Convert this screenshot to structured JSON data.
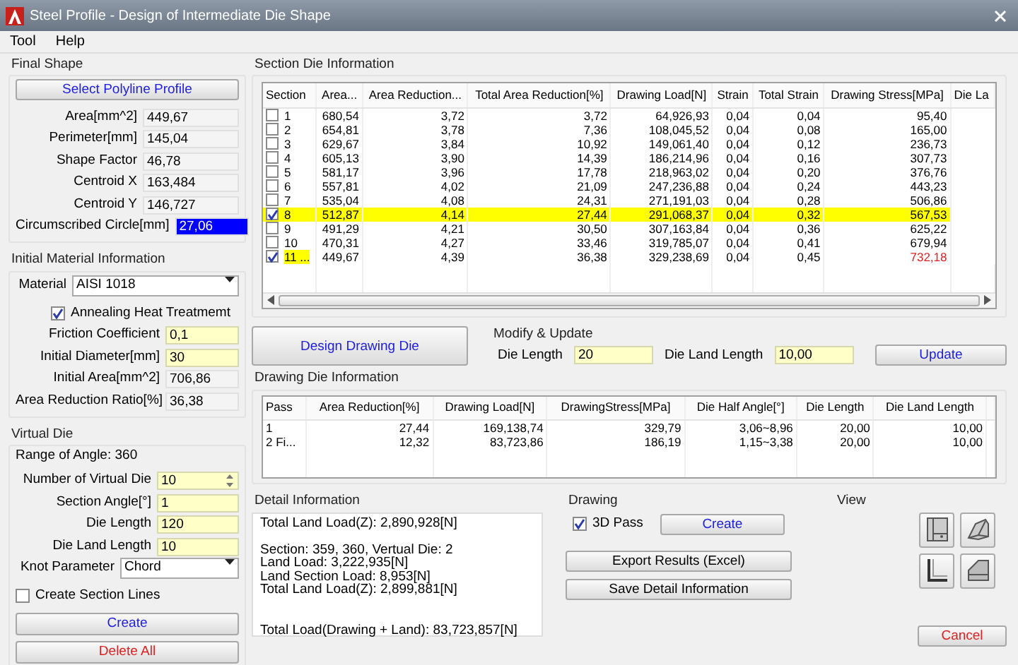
{
  "window": {
    "title": "Steel Profile - Design of Intermediate Die Shape"
  },
  "menu": [
    "Tool",
    "Help"
  ],
  "final_shape": {
    "title": "Final Shape",
    "button": "Select Polyline Profile",
    "fields": [
      {
        "label": "Area[mm^2]",
        "value": "449,67",
        "selected": false
      },
      {
        "label": "Perimeter[mm]",
        "value": "145,04",
        "selected": false
      },
      {
        "label": "Shape Factor",
        "value": "46,78",
        "selected": false
      },
      {
        "label": "Centroid X",
        "value": "163,484",
        "selected": false
      },
      {
        "label": "Centroid Y",
        "value": "146,727",
        "selected": false
      },
      {
        "label": "Circumscribed Circle[mm]",
        "value": "27,06",
        "selected": true
      }
    ]
  },
  "material": {
    "title": "Initial Material Information",
    "label": "Material",
    "value": "AISI 1018",
    "annealing": {
      "label": "Annealing Heat Treatmemt",
      "checked": true
    },
    "fields": [
      {
        "label": "Friction Coefficient",
        "value": "0,1",
        "editable": true
      },
      {
        "label": "Initial Diameter[mm]",
        "value": "30",
        "editable": true
      },
      {
        "label": "Initial Area[mm^2]",
        "value": "706,86",
        "editable": false
      },
      {
        "label": "Area Reduction Ratio[%]",
        "value": "36,38",
        "editable": false
      }
    ]
  },
  "virtual_die": {
    "title": "Virtual Die",
    "range": "Range of Angle: 360",
    "fields": [
      {
        "label": "Number of  Virtual Die",
        "value": "10",
        "kind": "spin"
      },
      {
        "label": "Section Angle[°]",
        "value": "1",
        "kind": "input"
      },
      {
        "label": "Die Length",
        "value": "120",
        "kind": "input"
      },
      {
        "label": "Die Land Length",
        "value": "10",
        "kind": "input"
      },
      {
        "label": "Knot Parameter",
        "value": "Chord",
        "kind": "select"
      }
    ],
    "section_lines": {
      "label": "Create Section Lines",
      "checked": false
    },
    "create": "Create",
    "delete": "Delete All"
  },
  "section_table": {
    "title": "Section Die Information",
    "columns": [
      "Section",
      "Area...",
      "Area Reduction...",
      "Total Area Reduction[%]",
      "Drawing Load[N]",
      "Strain",
      "Total Strain",
      "Drawing Stress[MPa]",
      "Die La"
    ],
    "rows": [
      {
        "checked": false,
        "highlighted": false,
        "marked": false,
        "over": false,
        "cells": [
          "1",
          "680,54",
          "3,72",
          "3,72",
          "64,926,93",
          "0,04",
          "0,04",
          "95,40"
        ]
      },
      {
        "checked": false,
        "highlighted": false,
        "marked": false,
        "over": false,
        "cells": [
          "2",
          "654,81",
          "3,78",
          "7,36",
          "108,045,52",
          "0,04",
          "0,08",
          "165,00"
        ]
      },
      {
        "checked": false,
        "highlighted": false,
        "marked": false,
        "over": false,
        "cells": [
          "3",
          "629,67",
          "3,84",
          "10,92",
          "149,061,40",
          "0,04",
          "0,12",
          "236,73"
        ]
      },
      {
        "checked": false,
        "highlighted": false,
        "marked": false,
        "over": false,
        "cells": [
          "4",
          "605,13",
          "3,90",
          "14,39",
          "186,214,96",
          "0,04",
          "0,16",
          "307,73"
        ]
      },
      {
        "checked": false,
        "highlighted": false,
        "marked": false,
        "over": false,
        "cells": [
          "5",
          "581,17",
          "3,96",
          "17,78",
          "218,963,02",
          "0,04",
          "0,20",
          "376,76"
        ]
      },
      {
        "checked": false,
        "highlighted": false,
        "marked": false,
        "over": false,
        "cells": [
          "6",
          "557,81",
          "4,02",
          "21,09",
          "247,236,88",
          "0,04",
          "0,24",
          "443,23"
        ]
      },
      {
        "checked": false,
        "highlighted": false,
        "marked": false,
        "over": false,
        "cells": [
          "7",
          "535,04",
          "4,08",
          "24,31",
          "271,191,03",
          "0,04",
          "0,28",
          "506,86"
        ]
      },
      {
        "checked": true,
        "highlighted": true,
        "marked": false,
        "over": false,
        "cells": [
          "8",
          "512,87",
          "4,14",
          "27,44",
          "291,068,37",
          "0,04",
          "0,32",
          "567,53"
        ]
      },
      {
        "checked": false,
        "highlighted": false,
        "marked": false,
        "over": false,
        "cells": [
          "9",
          "491,29",
          "4,21",
          "30,50",
          "307,163,84",
          "0,04",
          "0,36",
          "625,22"
        ]
      },
      {
        "checked": false,
        "highlighted": false,
        "marked": false,
        "over": false,
        "cells": [
          "10",
          "470,31",
          "4,27",
          "33,46",
          "319,785,07",
          "0,04",
          "0,41",
          "679,94"
        ]
      },
      {
        "checked": true,
        "highlighted": false,
        "marked": true,
        "over": true,
        "cells": [
          "11 ...",
          "449,67",
          "4,39",
          "36,38",
          "329,238,69",
          "0,04",
          "0,45",
          "732,18"
        ]
      }
    ]
  },
  "design_button": "Design Drawing Die",
  "modify": {
    "title": "Modify & Update",
    "fields": [
      {
        "label": "Die Length",
        "value": "20"
      },
      {
        "label": "Die Land Length",
        "value": "10,00"
      }
    ],
    "button": "Update"
  },
  "die_table": {
    "title": "Drawing Die Information",
    "columns": [
      "Pass",
      "Area Reduction[%]",
      "Drawing Load[N]",
      "DrawingStress[MPa]",
      "Die Half Angle[°]",
      "Die Length",
      "Die Land Length"
    ],
    "rows": [
      [
        "1",
        "27,44",
        "169,138,74",
        "329,79",
        "3,06~8,96",
        "20,00",
        "10,00"
      ],
      [
        "2 Fi...",
        "12,32",
        "83,723,86",
        "186,19",
        "1,15~3,38",
        "20,00",
        "10,00"
      ]
    ]
  },
  "detail": {
    "title": "Detail Information",
    "blocks": [
      [
        "Total Land Load(Z): 2,890,928[N]"
      ],
      [
        "Section: 359, 360,   Vertual Die: 2",
        "Land Load: 3,222,935[N]",
        "Land Section Load: 8,953[N]",
        "Total Land Load(Z): 2,899,881[N]"
      ],
      [
        "Total Load(Drawing + Land): 83,723,857[N]"
      ]
    ]
  },
  "drawing": {
    "title": "Drawing",
    "pass3d": {
      "label": "3D Pass",
      "checked": true
    },
    "create": "Create",
    "export": "Export Results (Excel)",
    "save": "Save Detail Information"
  },
  "view": {
    "title": "View"
  },
  "cancel": "Cancel"
}
